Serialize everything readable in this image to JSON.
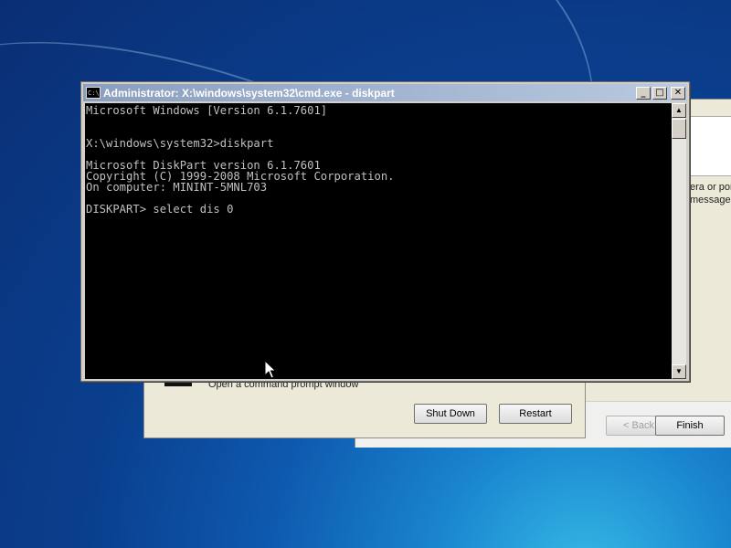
{
  "cmd_window": {
    "title": "Administrator: X:\\windows\\system32\\cmd.exe - diskpart",
    "icon_text": "C:\\",
    "minimize_glyph": "_",
    "maximize_glyph": "□",
    "close_glyph": "✕",
    "console_lines": [
      "Microsoft Windows [Version 6.1.7601]",
      "",
      "",
      "X:\\windows\\system32>diskpart",
      "",
      "Microsoft DiskPart version 6.1.7601",
      "Copyright (C) 1999-2008 Microsoft Corporation.",
      "On computer: MININT-5MNL703",
      "",
      "DISKPART> select dis 0"
    ],
    "scroll_up_glyph": "▲",
    "scroll_down_glyph": "▼"
  },
  "background_wizard": {
    "partial_text_1": "era or por",
    "partial_text_2": "message",
    "back_label": "< Back",
    "finish_label": "Finish"
  },
  "recovery_dialog": {
    "option_text": "Open a command prompt window",
    "shutdown_label": "Shut Down",
    "restart_label": "Restart"
  },
  "icons": {
    "cmd_icon": "command-prompt-icon",
    "cursor": "mouse-pointer-icon"
  }
}
